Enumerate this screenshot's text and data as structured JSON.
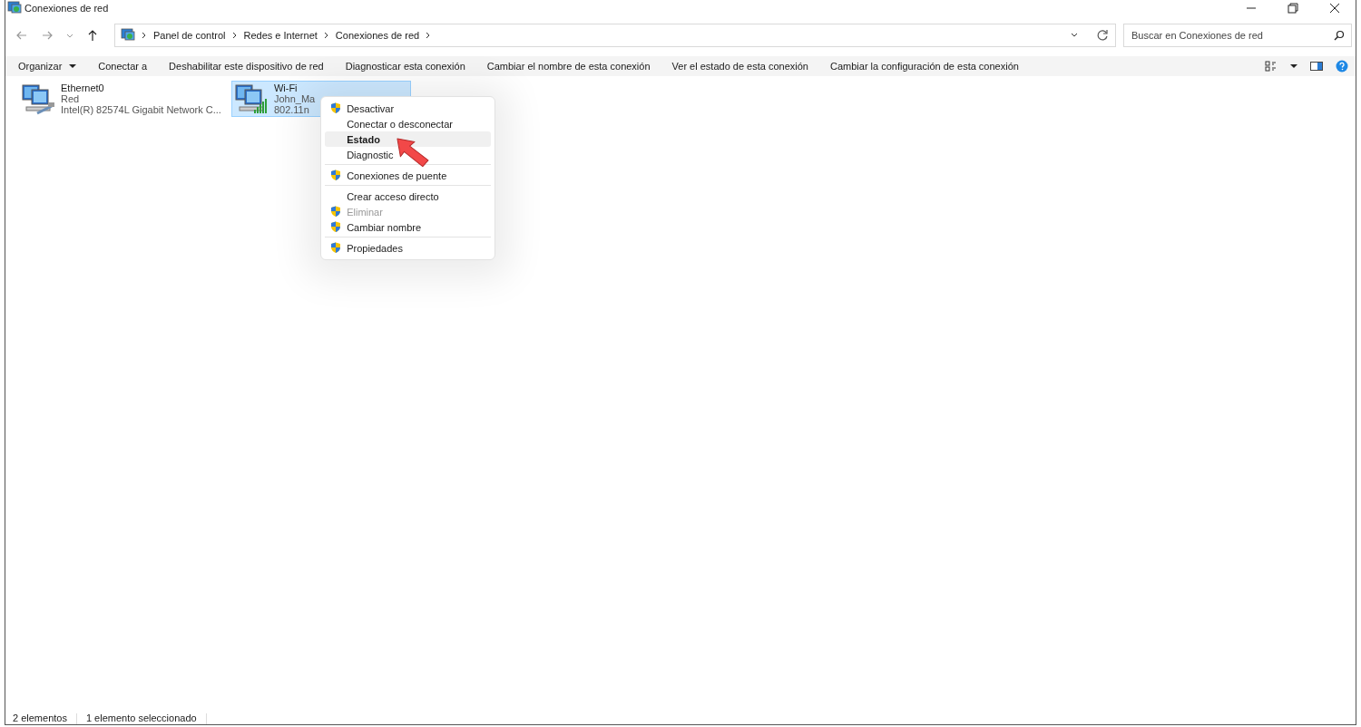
{
  "window": {
    "title": "Conexiones de red"
  },
  "address": {
    "breadcrumb": [
      "Panel de control",
      "Redes e Internet",
      "Conexiones de red"
    ]
  },
  "search": {
    "placeholder": "Buscar en Conexiones de red"
  },
  "toolbar": [
    {
      "label": "Organizar",
      "dropdown": true
    },
    {
      "label": "Conectar a",
      "dropdown": false
    },
    {
      "label": "Deshabilitar este dispositivo de red",
      "dropdown": false
    },
    {
      "label": "Diagnosticar esta conexión",
      "dropdown": false
    },
    {
      "label": "Cambiar el nombre de esta conexión",
      "dropdown": false
    },
    {
      "label": "Ver el estado de esta conexión",
      "dropdown": false
    },
    {
      "label": "Cambiar la configuración de esta conexión",
      "dropdown": false
    }
  ],
  "connections": [
    {
      "kind": "ethernet",
      "name": "Ethernet0",
      "line_2": "Red",
      "line_3": "Intel(R) 82574L Gigabit Network C...",
      "selected": false
    },
    {
      "kind": "wifi",
      "name": "Wi-Fi",
      "line_2": "John_Ma",
      "line_3": "802.11n",
      "selected": true
    }
  ],
  "context_menu": {
    "items": [
      {
        "label": "Desactivar",
        "shield": true,
        "bold": false,
        "disabled": false,
        "highlighted": false,
        "separator_after": false
      },
      {
        "label": "Conectar o desconectar",
        "shield": false,
        "bold": false,
        "disabled": false,
        "highlighted": false,
        "separator_after": false
      },
      {
        "label": "Estado",
        "shield": false,
        "bold": true,
        "disabled": false,
        "highlighted": true,
        "separator_after": false
      },
      {
        "label": "Diagnostic",
        "shield": false,
        "bold": false,
        "disabled": false,
        "highlighted": false,
        "separator_after": true
      },
      {
        "label": "Conexiones de puente",
        "shield": true,
        "bold": false,
        "disabled": false,
        "highlighted": false,
        "separator_after": true
      },
      {
        "label": "Crear acceso directo",
        "shield": false,
        "bold": false,
        "disabled": false,
        "highlighted": false,
        "separator_after": false
      },
      {
        "label": "Eliminar",
        "shield": true,
        "bold": false,
        "disabled": true,
        "highlighted": false,
        "separator_after": false
      },
      {
        "label": "Cambiar nombre",
        "shield": true,
        "bold": false,
        "disabled": false,
        "highlighted": false,
        "separator_after": true
      },
      {
        "label": "Propiedades",
        "shield": true,
        "bold": false,
        "disabled": false,
        "highlighted": false,
        "separator_after": false
      }
    ]
  },
  "status_bar": {
    "count": "2 elementos",
    "selection": "1 elemento seleccionado"
  }
}
